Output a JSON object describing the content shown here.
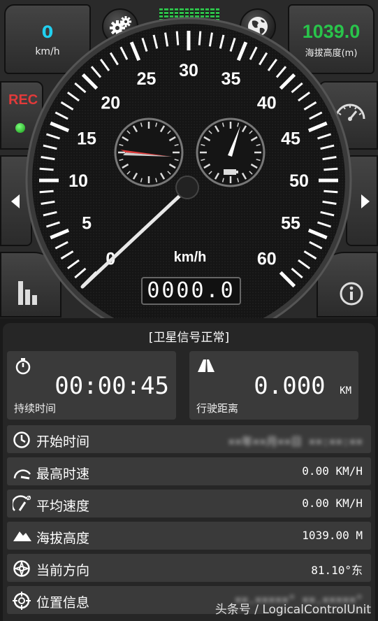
{
  "speed_box": {
    "value": "0",
    "unit": "km/h"
  },
  "altitude_box": {
    "value": "1039.0",
    "unit": "海拔高度(m)"
  },
  "rec": {
    "label": "REC"
  },
  "dial": {
    "labels": [
      "0",
      "5",
      "10",
      "15",
      "20",
      "25",
      "30",
      "35",
      "40",
      "45",
      "50",
      "55",
      "60"
    ],
    "unit": "km/h",
    "speed": 0
  },
  "odometer": {
    "value": "0000.0"
  },
  "status": "[卫星信号正常]",
  "duration": {
    "value": "00:00:45",
    "label": "持续时间"
  },
  "distance": {
    "value": "0.000",
    "unit": "KM",
    "label": "行驶距离"
  },
  "rows": [
    {
      "label": "开始时间",
      "value": "××年××月××日 ××:××:××"
    },
    {
      "label": "最高时速",
      "value": "0.00 KM/H"
    },
    {
      "label": "平均速度",
      "value": "0.00 KM/H"
    },
    {
      "label": "海拔高度",
      "value": "1039.00 M"
    },
    {
      "label": "当前方向",
      "value": "81.10°东"
    },
    {
      "label": "位置信息",
      "value": "××.×××××° ××.×××××°"
    }
  ],
  "watermark": "头条号 / LogicalControlUnit",
  "colors": {
    "speed": "#21d0f0",
    "altitude": "#29c44b",
    "rec": "#e23a3a"
  }
}
